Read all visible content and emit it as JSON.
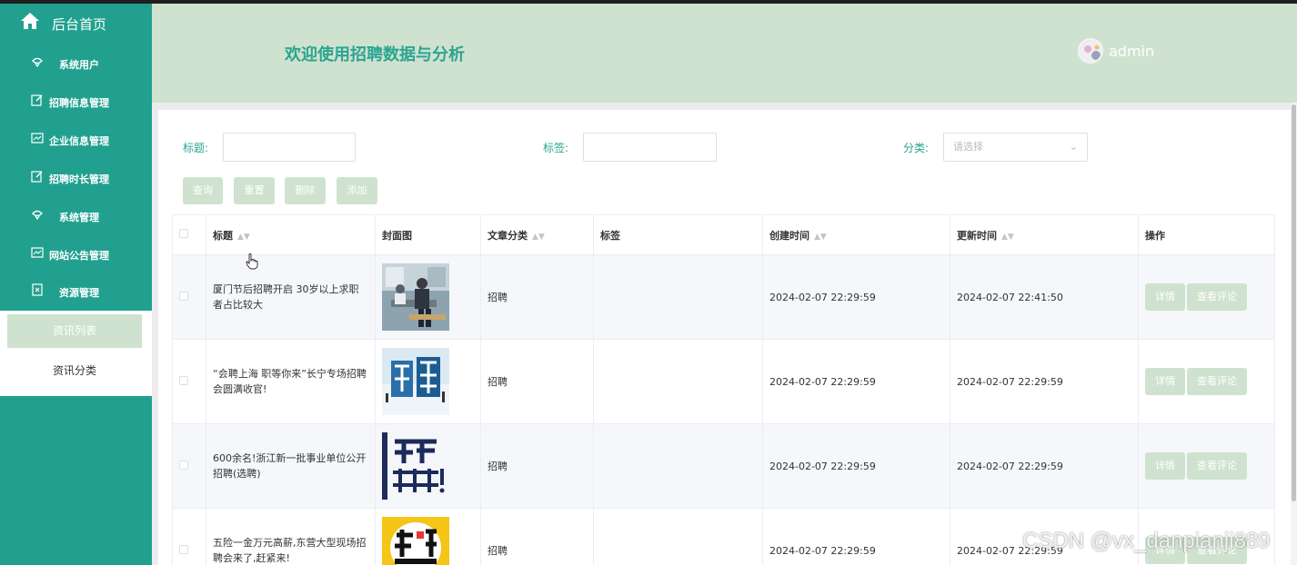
{
  "sidebar": {
    "home_label": "后台首页",
    "items": [
      {
        "label": "系统用户",
        "icon": "chat-bubble-icon"
      },
      {
        "label": "招聘信息管理",
        "icon": "edit-icon"
      },
      {
        "label": "企业信息管理",
        "icon": "card-icon"
      },
      {
        "label": "招聘时长管理",
        "icon": "edit-icon"
      },
      {
        "label": "系统管理",
        "icon": "chat-bubble-icon"
      },
      {
        "label": "网站公告管理",
        "icon": "chart-icon"
      },
      {
        "label": "资源管理",
        "icon": "document-icon"
      }
    ],
    "subitems": [
      {
        "label": "资讯列表",
        "active": true
      },
      {
        "label": "资讯分类",
        "active": false
      }
    ]
  },
  "header": {
    "title": "欢迎使用招聘数据与分析",
    "username": "admin"
  },
  "filters": {
    "title_label": "标题:",
    "tag_label": "标签:",
    "category_label": "分类:",
    "category_placeholder": "请选择"
  },
  "buttons": {
    "query": "查询",
    "reset": "重置",
    "delete": "删除",
    "add": "添加"
  },
  "table": {
    "columns": [
      "标题",
      "封面图",
      "文章分类",
      "标签",
      "创建时间",
      "更新时间",
      "操作"
    ],
    "rows": [
      {
        "title": "厦门节后招聘开启 30岁以上求职者占比较大",
        "category": "招聘",
        "tag": "",
        "created": "2024-02-07 22:29:59",
        "updated": "2024-02-07 22:41:50"
      },
      {
        "title": "“会聘上海 职等你来”长宁专场招聘会圆满收官!",
        "category": "招聘",
        "tag": "",
        "created": "2024-02-07 22:29:59",
        "updated": "2024-02-07 22:29:59"
      },
      {
        "title": "600余名!浙江新一批事业单位公开招聘(选聘)",
        "category": "招聘",
        "tag": "",
        "created": "2024-02-07 22:29:59",
        "updated": "2024-02-07 22:29:59"
      },
      {
        "title": "五险一金万元高薪,东营大型现场招聘会来了,赶紧来!",
        "category": "招聘",
        "tag": "",
        "created": "2024-02-07 22:29:59",
        "updated": "2024-02-07 22:29:59"
      }
    ],
    "action_detail": "详情",
    "action_comments": "查看评论"
  },
  "watermark": "CSDN @vx_danpianji889",
  "colors": {
    "sidebar": "#21a08f",
    "header": "#cfe2cf",
    "accent_text": "#2aa591",
    "button": "#cfe2cf"
  }
}
